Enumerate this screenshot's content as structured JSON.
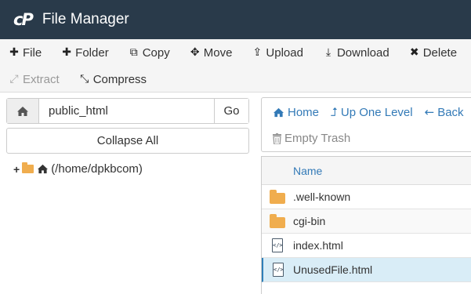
{
  "header": {
    "logo": "cP",
    "title": "File Manager"
  },
  "toolbar": {
    "row1": [
      {
        "icon": "plus-icon",
        "glyph": "✚",
        "label": "File"
      },
      {
        "icon": "plus-icon",
        "glyph": "✚",
        "label": "Folder"
      },
      {
        "icon": "copy-icon",
        "glyph": "⧉",
        "label": "Copy"
      },
      {
        "icon": "move-icon",
        "glyph": "✥",
        "label": "Move"
      },
      {
        "icon": "upload-icon",
        "glyph": "⇪",
        "label": "Upload"
      },
      {
        "icon": "download-icon",
        "glyph": "⤓",
        "label": "Download"
      },
      {
        "icon": "delete-icon",
        "glyph": "✖",
        "label": "Delete"
      }
    ],
    "row2": [
      {
        "icon": "extract-icon",
        "glyph": "⤢",
        "label": "Extract",
        "disabled": true
      },
      {
        "icon": "compress-icon",
        "glyph": "⤡",
        "label": "Compress",
        "disabled": false
      }
    ]
  },
  "pathbar": {
    "value": "public_html",
    "go_label": "Go"
  },
  "collapse_label": "Collapse All",
  "tree": {
    "root_label": "(/home/dpkbcom)"
  },
  "nav": {
    "home": "Home",
    "up_one_level": "Up One Level",
    "back": "Back",
    "empty_trash": "Empty Trash"
  },
  "table": {
    "column_name": "Name",
    "rows": [
      {
        "type": "folder",
        "name": ".well-known",
        "selected": false
      },
      {
        "type": "folder",
        "name": "cgi-bin",
        "selected": false
      },
      {
        "type": "file",
        "name": "index.html",
        "selected": false
      },
      {
        "type": "file",
        "name": "UnusedFile.html",
        "selected": true
      }
    ]
  },
  "colors": {
    "header_bg": "#293a4a",
    "link": "#337ab7",
    "folder": "#f0ad4e",
    "selected_row": "#d9edf7"
  }
}
